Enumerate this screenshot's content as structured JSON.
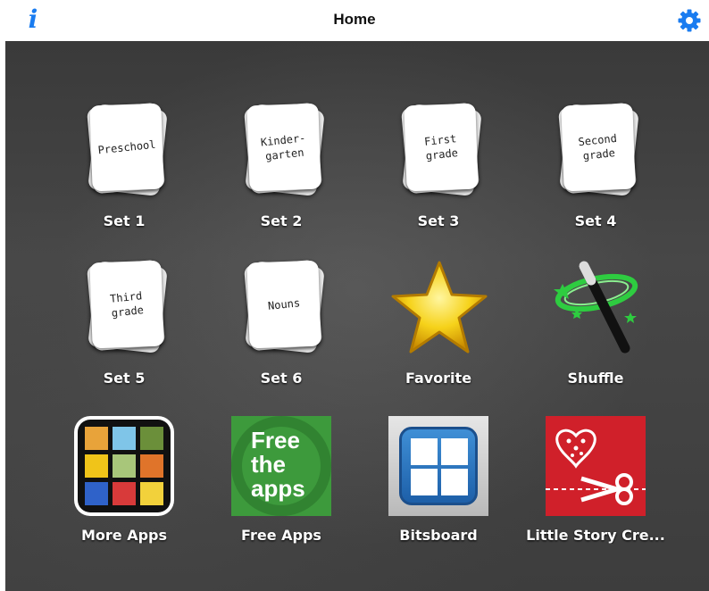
{
  "navbar": {
    "title": "Home",
    "info_glyph": "i",
    "info_icon": "info-icon",
    "settings_icon": "gear-icon",
    "accent_color": "#1a7cf0"
  },
  "sets": [
    {
      "label": "Set 1",
      "card_text": "Preschool"
    },
    {
      "label": "Set 2",
      "card_text": "Kinder-\ngarten"
    },
    {
      "label": "Set 3",
      "card_text": "First\ngrade"
    },
    {
      "label": "Set 4",
      "card_text": "Second\ngrade"
    },
    {
      "label": "Set 5",
      "card_text": "Third\ngrade"
    },
    {
      "label": "Set 6",
      "card_text": "Nouns"
    }
  ],
  "favorite": {
    "label": "Favorite",
    "icon": "star-icon"
  },
  "shuffle": {
    "label": "Shuffle",
    "icon": "magic-wand-icon"
  },
  "apps": [
    {
      "label": "More Apps",
      "icon": "more-apps-grid-icon"
    },
    {
      "label": "Free Apps",
      "icon": "free-the-apps-icon",
      "icon_text": [
        "Free",
        "the",
        "apps"
      ]
    },
    {
      "label": "Bitsboard",
      "icon": "bitsboard-icon"
    },
    {
      "label": "Little Story Cre...",
      "icon": "little-story-creator-icon"
    }
  ]
}
